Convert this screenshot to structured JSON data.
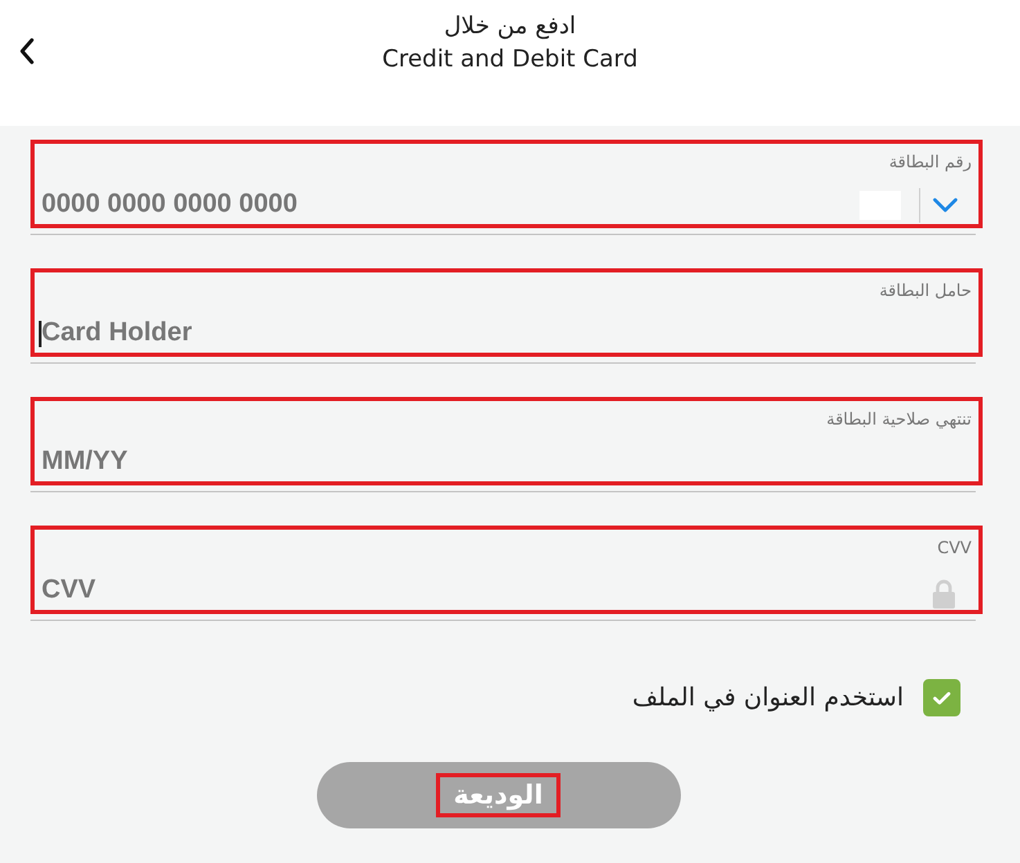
{
  "header": {
    "title": "ادفع من خلال",
    "subtitle": "Credit and Debit Card"
  },
  "fields": [
    {
      "kind": "card_number",
      "label": "رقم البطاقة",
      "placeholder": "0000 0000 0000 0000",
      "highlighted": true,
      "focused": false
    },
    {
      "kind": "text",
      "label": "حامل البطاقة",
      "placeholder": "Card Holder",
      "highlighted": true,
      "focused": true
    },
    {
      "kind": "text",
      "label": "تنتهي صلاحية البطاقة",
      "placeholder": "MM/YY",
      "highlighted": true,
      "focused": false
    },
    {
      "kind": "cvv",
      "label": "CVV",
      "placeholder": "CVV",
      "highlighted": true,
      "focused": false
    }
  ],
  "address_checkbox": {
    "label": "استخدم العنوان في الملف",
    "checked": true
  },
  "submit_button": {
    "label": "الوديعة",
    "disabled": true,
    "highlighted": true
  }
}
